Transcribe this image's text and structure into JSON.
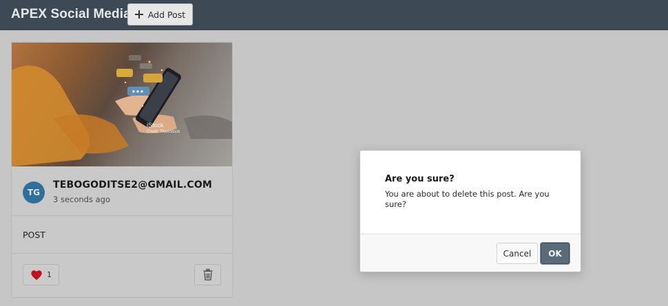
{
  "header": {
    "app_title": "APEX Social Media",
    "add_post_label": "Add Post",
    "background_color": "#3d4a55"
  },
  "post_card": {
    "image_watermark": "iStock",
    "image_credit": "Credit: ThxAStock",
    "avatar_initials": "TG",
    "avatar_color": "#2f6f9c",
    "author": "TEBOGODITSE2@GMAIL.COM",
    "time": "3 seconds ago",
    "text": "POST",
    "like_count": "1",
    "like_icon": "heart-icon",
    "delete_icon": "trash-icon"
  },
  "dialog": {
    "title": "Are you sure?",
    "message": "You are about to delete this post. Are you sure?",
    "cancel_label": "Cancel",
    "ok_label": "OK",
    "ok_color": "#5a6a79"
  }
}
